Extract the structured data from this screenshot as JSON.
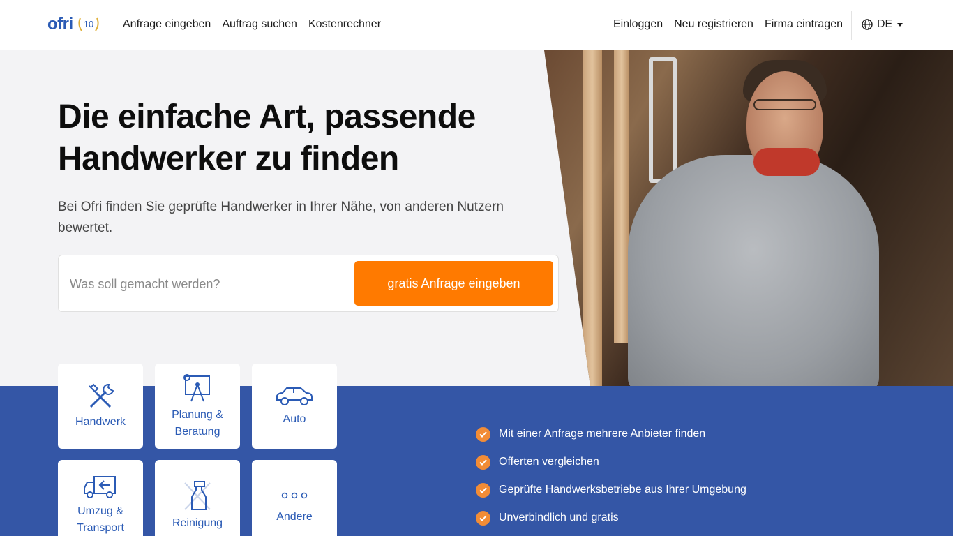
{
  "header": {
    "logo_text": "ofri",
    "logo_badge": "10",
    "nav_left": [
      "Anfrage eingeben",
      "Auftrag suchen",
      "Kostenrechner"
    ],
    "nav_right": [
      "Einloggen",
      "Neu registrieren",
      "Firma eintragen"
    ],
    "language": "DE"
  },
  "hero": {
    "title_line1": "Die einfache Art, passende",
    "title_line2": "Handwerker zu finden",
    "subtitle": "Bei Ofri finden Sie geprüfte Handwerker in Ihrer Nähe, von anderen Nutzern bewertet.",
    "search_placeholder": "Was soll gemacht werden?",
    "search_value": "",
    "cta_label": "gratis Anfrage eingeben"
  },
  "categories": [
    {
      "label": "Handwerk",
      "icon": "tools-icon"
    },
    {
      "label": "Planung & Beratung",
      "icon": "blueprint-icon"
    },
    {
      "label": "Auto",
      "icon": "car-icon"
    },
    {
      "label": "Umzug & Transport",
      "icon": "truck-icon"
    },
    {
      "label": "Reinigung",
      "icon": "spray-bottle-icon"
    },
    {
      "label": "Andere",
      "icon": "more-icon"
    }
  ],
  "benefits": [
    "Mit einer Anfrage mehrere Anbieter finden",
    "Offerten vergleichen",
    "Geprüfte Handwerksbetriebe aus Ihrer Umgebung",
    "Unverbindlich und gratis"
  ],
  "colors": {
    "brand_blue": "#3456a6",
    "cta_orange": "#ff7a00",
    "check_orange": "#f28c36",
    "hero_bg": "#f3f3f5"
  }
}
